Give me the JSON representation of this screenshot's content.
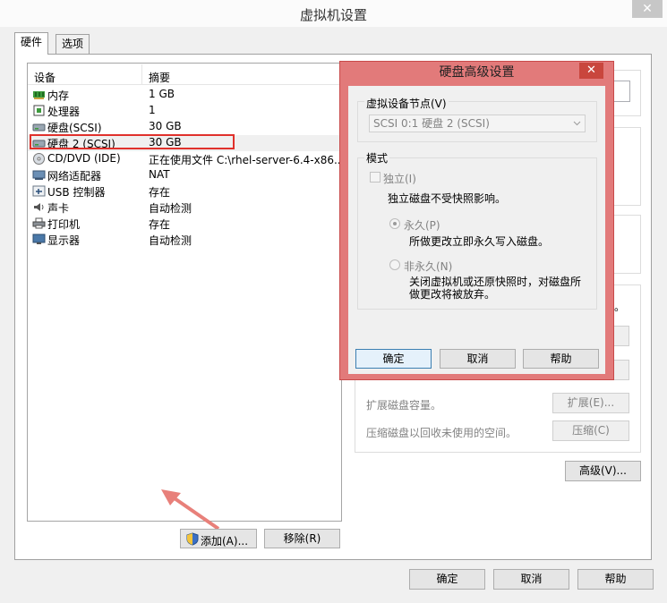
{
  "window": {
    "title": "虚拟机设置",
    "close_glyph": "✕"
  },
  "tabs": [
    {
      "label": "硬件"
    },
    {
      "label": "选项"
    }
  ],
  "device_list": {
    "col_device": "设备",
    "col_summary": "摘要",
    "rows": [
      {
        "name": "内存",
        "summary": "1 GB",
        "icon": "memory-icon"
      },
      {
        "name": "处理器",
        "summary": "1",
        "icon": "cpu-icon"
      },
      {
        "name": "硬盘(SCSI)",
        "summary": "30 GB",
        "icon": "hard-disk-icon"
      },
      {
        "name": "硬盘 2 (SCSI)",
        "summary": "30 GB",
        "icon": "hard-disk-icon"
      },
      {
        "name": "CD/DVD (IDE)",
        "summary": "正在使用文件 C:\\rhel-server-6.4-x86...",
        "icon": "cd-dvd-icon"
      },
      {
        "name": "网络适配器",
        "summary": "NAT",
        "icon": "network-adapter-icon"
      },
      {
        "name": "USB 控制器",
        "summary": "存在",
        "icon": "usb-icon"
      },
      {
        "name": "声卡",
        "summary": "自动检测",
        "icon": "sound-card-icon"
      },
      {
        "name": "打印机",
        "summary": "存在",
        "icon": "printer-icon"
      },
      {
        "name": "显示器",
        "summary": "自动检测",
        "icon": "monitor-icon"
      }
    ]
  },
  "list_buttons": {
    "add": "添加(A)...",
    "remove": "移除(R)"
  },
  "right_panel": {
    "partial_text_1": "。",
    "expand_text": "扩展磁盘容量。",
    "expand_button": "扩展(E)...",
    "compact_text": "压缩磁盘以回收未使用的空间。",
    "compact_button": "压缩(C)",
    "advanced_button": "高级(V)..."
  },
  "dialog": {
    "title": "硬盘高级设置",
    "close_glyph": "✕",
    "node_group": "虚拟设备节点(V)",
    "node_value": "SCSI 0:1   硬盘 2 (SCSI)",
    "mode_group": "模式",
    "independent_label": "独立(I)",
    "independent_desc": "独立磁盘不受快照影响。",
    "persistent_label": "永久(P)",
    "persistent_desc": "所做更改立即永久写入磁盘。",
    "nonpersistent_label": "非永久(N)",
    "nonpersistent_desc_1": "关闭虚拟机或还原快照时，对磁盘所",
    "nonpersistent_desc_2": "做更改将被放弃。",
    "ok": "确定",
    "cancel": "取消",
    "help": "帮助"
  },
  "footer": {
    "ok": "确定",
    "cancel": "取消",
    "help": "帮助"
  },
  "colors": {
    "highlight": "#e0312c",
    "arrow": "#e8807a",
    "dialog_frame": "#e27a7a"
  }
}
